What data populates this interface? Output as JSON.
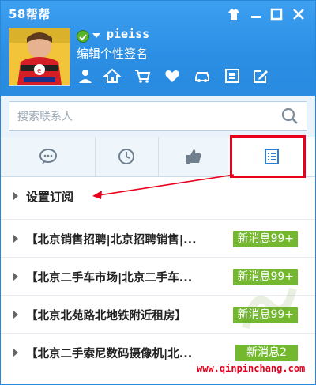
{
  "app": {
    "title": "58帮帮"
  },
  "window_controls": [
    "shirt-icon",
    "minimize-icon",
    "maximize-icon",
    "close-icon"
  ],
  "profile": {
    "username": "pieiss",
    "signature": "编辑个性签名",
    "status": "online"
  },
  "toolbar_icons": [
    "user-icon",
    "home-icon",
    "cart-icon",
    "heart-icon",
    "car-icon",
    "grid-icon",
    "edit-icon"
  ],
  "search": {
    "placeholder": "搜索联系人"
  },
  "tabs": [
    {
      "name": "messages",
      "icon": "chat-bubble-icon"
    },
    {
      "name": "recent",
      "icon": "clock-icon"
    },
    {
      "name": "likes",
      "icon": "thumbs-up-icon"
    },
    {
      "name": "subscriptions",
      "icon": "list-icon",
      "active": true
    }
  ],
  "section": {
    "label": "设置订阅"
  },
  "subscriptions": [
    {
      "title": "【北京销售招聘|北京招聘销售|...",
      "badge": "新消息99+"
    },
    {
      "title": "【北京二手车市场|北京二手车...",
      "badge": "新消息99+"
    },
    {
      "title": "【北京北苑路北地铁附近租房】",
      "badge": "新消息99+"
    },
    {
      "title": "【北京二手索尼数码摄像机|北...",
      "badge": "新消息2"
    }
  ],
  "watermark": "www.qinpinchang.com",
  "colors": {
    "header": "#2b8ee3",
    "badge": "#74b830",
    "highlight": "#e8001c"
  }
}
